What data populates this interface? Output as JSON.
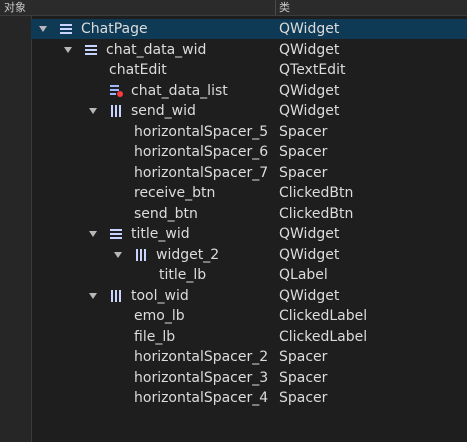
{
  "header": {
    "col_object": "对象",
    "col_class": "类"
  },
  "rows": [
    {
      "name": "ChatPage",
      "class": "QWidget",
      "selected": true,
      "indent": 0,
      "arrow": true,
      "icon": "vertical-layout"
    },
    {
      "name": "chat_data_wid",
      "class": "QWidget",
      "indent": 1,
      "arrow": true,
      "icon": "vertical-layout"
    },
    {
      "name": "chatEdit",
      "class": "QTextEdit",
      "indent": 2
    },
    {
      "name": "chat_data_list",
      "class": "QWidget",
      "indent": 2,
      "icon": "list-widget"
    },
    {
      "name": "send_wid",
      "class": "QWidget",
      "indent": 2,
      "arrow": true,
      "icon": "horizontal-layout"
    },
    {
      "name": "horizontalSpacer_5",
      "class": "Spacer",
      "indent": 3
    },
    {
      "name": "horizontalSpacer_6",
      "class": "Spacer",
      "indent": 3
    },
    {
      "name": "horizontalSpacer_7",
      "class": "Spacer",
      "indent": 3
    },
    {
      "name": "receive_btn",
      "class": "ClickedBtn",
      "indent": 3
    },
    {
      "name": "send_btn",
      "class": "ClickedBtn",
      "indent": 3
    },
    {
      "name": "title_wid",
      "class": "QWidget",
      "indent": 2,
      "arrow": true,
      "icon": "vertical-layout"
    },
    {
      "name": "widget_2",
      "class": "QWidget",
      "indent": 3,
      "arrow": true,
      "icon": "horizontal-layout"
    },
    {
      "name": "title_lb",
      "class": "QLabel",
      "indent": 4
    },
    {
      "name": "tool_wid",
      "class": "QWidget",
      "indent": 2,
      "arrow": true,
      "icon": "horizontal-layout"
    },
    {
      "name": "emo_lb",
      "class": "ClickedLabel",
      "indent": 3
    },
    {
      "name": "file_lb",
      "class": "ClickedLabel",
      "indent": 3
    },
    {
      "name": "horizontalSpacer_2",
      "class": "Spacer",
      "indent": 3
    },
    {
      "name": "horizontalSpacer_3",
      "class": "Spacer",
      "indent": 3
    },
    {
      "name": "horizontalSpacer_4",
      "class": "Spacer",
      "indent": 3
    }
  ]
}
